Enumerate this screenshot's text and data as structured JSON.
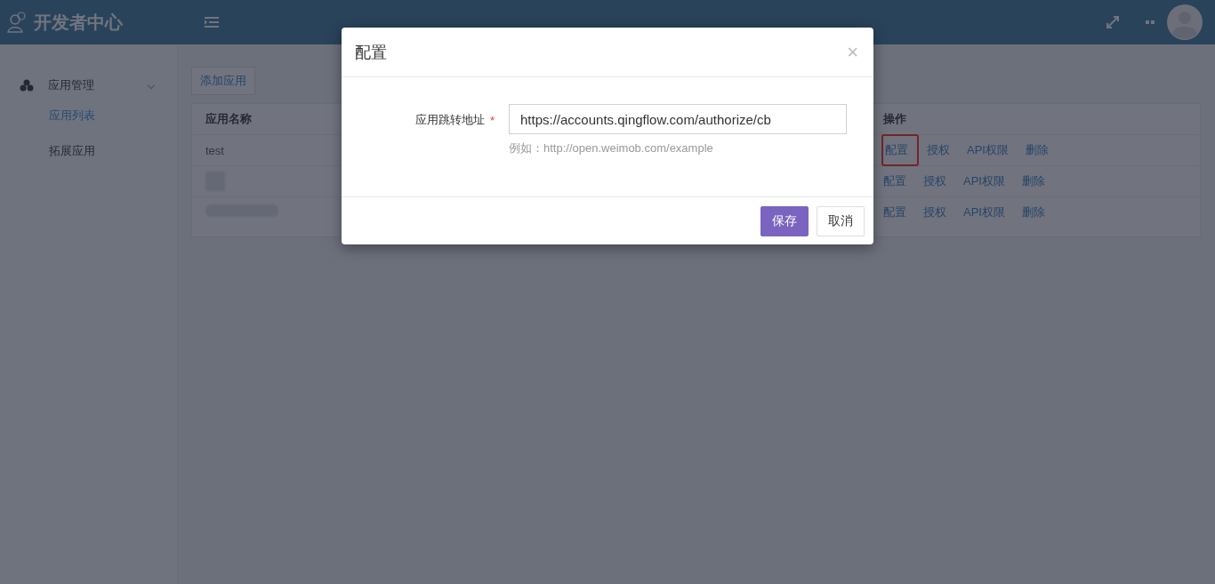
{
  "header": {
    "title": "开发者中心"
  },
  "sidebar": {
    "items": [
      {
        "label": "应用管理",
        "expanded": true,
        "children": [
          {
            "label": "应用列表",
            "selected": true
          },
          {
            "label": "拓展应用",
            "selected": false
          }
        ]
      }
    ]
  },
  "toolbar": {
    "add_button": "添加应用"
  },
  "table": {
    "columns": [
      "应用名称",
      "操作"
    ],
    "rows": [
      {
        "kind": "text",
        "name": "test",
        "actions": [
          {
            "label": "配置",
            "highlighted": true
          },
          {
            "label": "授权",
            "highlighted": false
          },
          {
            "label": "API权限",
            "highlighted": false
          },
          {
            "label": "删除",
            "highlighted": false
          }
        ]
      },
      {
        "kind": "blurred-square",
        "actions": [
          {
            "label": "配置",
            "highlighted": false
          },
          {
            "label": "授权",
            "highlighted": false
          },
          {
            "label": "API权限",
            "highlighted": false
          },
          {
            "label": "删除",
            "highlighted": false
          }
        ]
      },
      {
        "kind": "blurred-bar",
        "actions": [
          {
            "label": "配置",
            "highlighted": false
          },
          {
            "label": "授权",
            "highlighted": false
          },
          {
            "label": "API权限",
            "highlighted": false
          },
          {
            "label": "删除",
            "highlighted": false
          }
        ]
      }
    ]
  },
  "modal": {
    "title": "配置",
    "close": "×",
    "field": {
      "label": "应用跳转地址",
      "required_mark": "*",
      "value": "https://accounts.qingflow.com/authorize/cb",
      "hint": "例如：http://open.weimob.com/example"
    },
    "buttons": [
      {
        "label": "保存",
        "kind": "primary"
      },
      {
        "label": "取消",
        "kind": "default"
      }
    ]
  }
}
